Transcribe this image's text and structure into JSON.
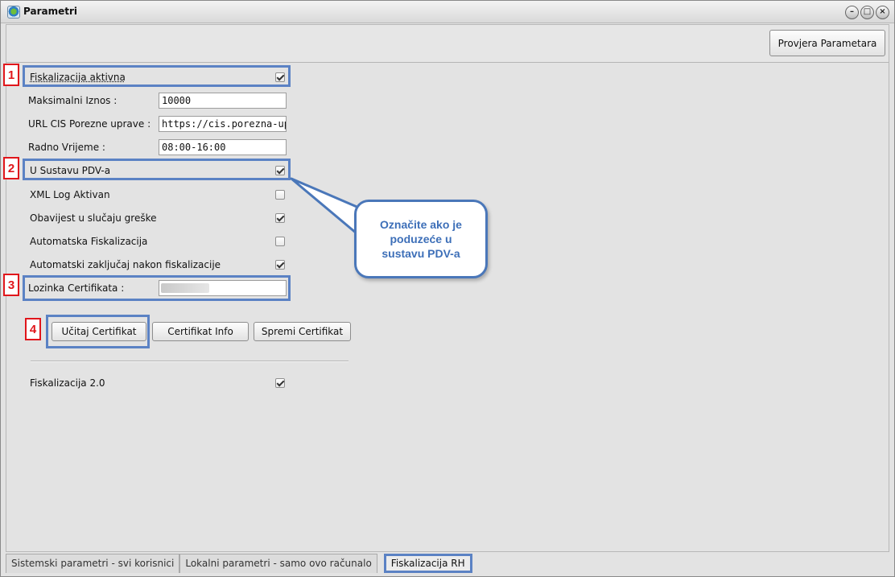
{
  "window": {
    "title": "Parametri",
    "controls": [
      "–",
      "□",
      "×"
    ]
  },
  "toolbar": {
    "check_params_label": "Provjera Parametara"
  },
  "form": {
    "fiscal_active_label": "Fiskalizacija aktivna",
    "fiscal_active_checked": true,
    "max_amount_label": "Maksimalni Iznos :",
    "max_amount_value": "10000",
    "url_cis_label": "URL CIS Porezne uprave :",
    "url_cis_value": "https://cis.porezna-uprava.",
    "working_hours_label": "Radno Vrijeme :",
    "working_hours_value": "08:00-16:00",
    "vat_system_label": "U Sustavu PDV-a",
    "vat_system_checked": true,
    "xml_log_label": "XML Log Aktivan",
    "xml_log_checked": false,
    "error_notify_label": "Obavijest u slučaju greške",
    "error_notify_checked": true,
    "auto_fiscal_label": "Automatska Fiskalizacija",
    "auto_fiscal_checked": false,
    "auto_lock_label": "Automatski zaključaj nakon fiskalizacije",
    "auto_lock_checked": true,
    "cert_password_label": "Lozinka Certifikata :",
    "fiscal2_label": "Fiskalizacija 2.0",
    "fiscal2_checked": true
  },
  "buttons": {
    "load_cert": "Učitaj Certifikat",
    "cert_info": "Certifikat Info",
    "save_cert": "Spremi Certifikat"
  },
  "annotations": {
    "markers": [
      "1",
      "2",
      "3",
      "4"
    ],
    "callout_text": "Označite ako je poduzeće u sustavu PDV-a"
  },
  "tabs": [
    {
      "label": "Sistemski parametri - svi korisnici",
      "active": false
    },
    {
      "label": "Lokalni parametri - samo ovo računalo",
      "active": false
    },
    {
      "label": "Fiskalizacija RH",
      "active": true
    }
  ],
  "colors": {
    "highlight": "#5b82c4",
    "marker": "#e0161b",
    "callout_text": "#3d6fb8"
  }
}
